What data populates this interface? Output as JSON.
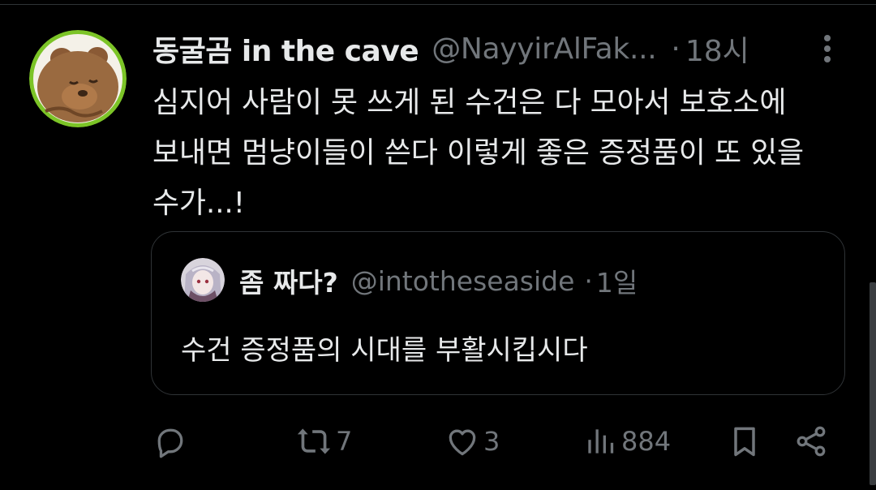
{
  "tweet": {
    "display_name": "동굴곰 in the cave",
    "handle": "@NayyirAlFak...",
    "dot": "·",
    "time": "18시",
    "text_lines": [
      "심지어 사람이 못 쓰게 된 수건은 다 모아서 보호소에",
      "보내면 멈냥이들이 쓴다 이렇게 좋은 증정품이 또 있을",
      "수가...!"
    ]
  },
  "quote": {
    "display_name": "좀 짜다?",
    "handle": "@intotheseaside",
    "dot": "·",
    "time": "1일",
    "text": "수건 증정품의 시대를 부활시킵시다"
  },
  "actions": {
    "reply_icon": "reply-icon",
    "retweet_icon": "retweet-icon",
    "retweet_count": "7",
    "like_icon": "heart-icon",
    "like_count": "3",
    "views_icon": "views-chart-icon",
    "views_count": "884",
    "bookmark_icon": "bookmark-icon",
    "share_icon": "share-icon"
  },
  "colors": {
    "background": "#000000",
    "text_primary": "#e7e9ea",
    "text_secondary": "#71767b",
    "border": "#2f3336",
    "avatar_ring": "#7cc427"
  }
}
